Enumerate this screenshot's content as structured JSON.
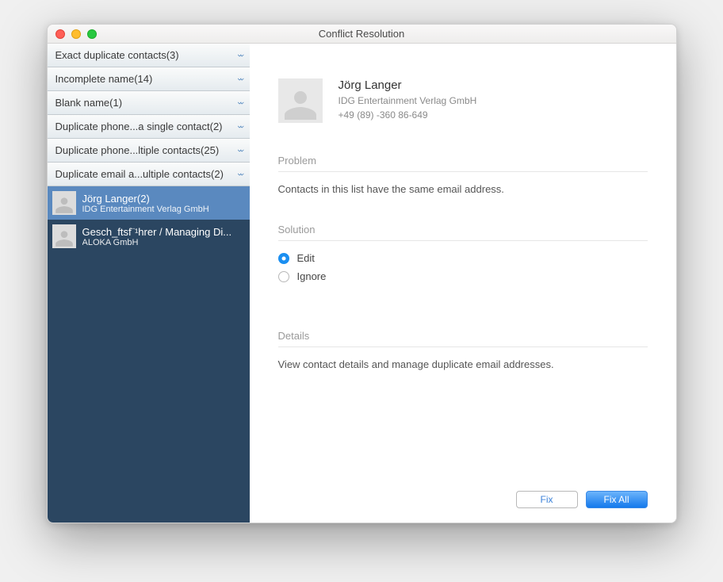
{
  "window": {
    "title": "Conflict Resolution"
  },
  "sidebar": {
    "categories": [
      {
        "label": "Exact duplicate contacts(3)"
      },
      {
        "label": "Incomplete name(14)"
      },
      {
        "label": "Blank name(1)"
      },
      {
        "label": "Duplicate phone...a single contact(2)"
      },
      {
        "label": "Duplicate phone...ltiple contacts(25)"
      },
      {
        "label": "Duplicate email a...ultiple contacts(2)"
      }
    ],
    "contacts": [
      {
        "name": "Jörg Langer(2)",
        "sub": "IDG Entertainment Verlag GmbH",
        "selected": true
      },
      {
        "name": "Gesch_ftsf¨¹hrer / Managing Di...",
        "sub": "ALOKA GmbH",
        "selected": false
      }
    ]
  },
  "detail": {
    "name": "Jörg Langer",
    "company": "IDG Entertainment Verlag GmbH",
    "phone": "+49 (89) -360 86-649",
    "problem_label": "Problem",
    "problem_text": "Contacts in this list have the same email address.",
    "solution_label": "Solution",
    "solutions": {
      "edit": "Edit",
      "ignore": "Ignore"
    },
    "details_label": "Details",
    "details_text": "View contact details and manage duplicate email addresses."
  },
  "buttons": {
    "fix": "Fix",
    "fix_all": "Fix All"
  }
}
